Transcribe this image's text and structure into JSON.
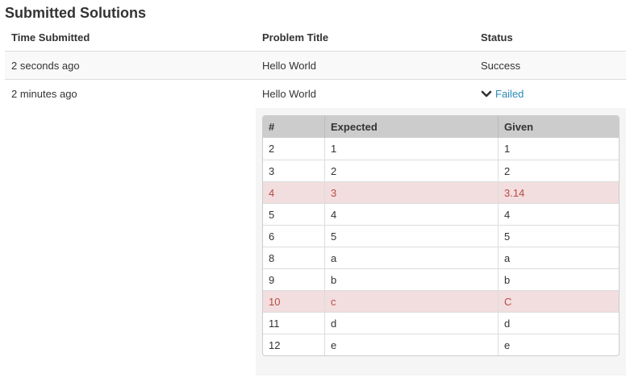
{
  "page": {
    "title": "Submitted Solutions"
  },
  "solutions_table": {
    "headers": {
      "time": "Time Submitted",
      "title": "Problem Title",
      "status": "Status"
    },
    "rows": [
      {
        "time": "2 seconds ago",
        "title": "Hello World",
        "status": "Success"
      },
      {
        "time": "2 minutes ago",
        "title": "Hello World",
        "status": "Failed"
      }
    ]
  },
  "details": {
    "headers": {
      "num": "#",
      "expected": "Expected",
      "given": "Given"
    },
    "rows": [
      {
        "num": "2",
        "expected": "1",
        "given": "1",
        "mismatch": false
      },
      {
        "num": "3",
        "expected": "2",
        "given": "2",
        "mismatch": false
      },
      {
        "num": "4",
        "expected": "3",
        "given": "3.14",
        "mismatch": true
      },
      {
        "num": "5",
        "expected": "4",
        "given": "4",
        "mismatch": false
      },
      {
        "num": "6",
        "expected": "5",
        "given": "5",
        "mismatch": false
      },
      {
        "num": "8",
        "expected": "a",
        "given": "a",
        "mismatch": false
      },
      {
        "num": "9",
        "expected": "b",
        "given": "b",
        "mismatch": false
      },
      {
        "num": "10",
        "expected": "c",
        "given": "C",
        "mismatch": true
      },
      {
        "num": "11",
        "expected": "d",
        "given": "d",
        "mismatch": false
      },
      {
        "num": "12",
        "expected": "e",
        "given": "e",
        "mismatch": false
      }
    ]
  },
  "colors": {
    "link": "#2a8ab8",
    "mismatch_bg": "#f2dede",
    "mismatch_text": "#b94a48",
    "header_bg": "#cccccc",
    "panel_bg": "#f5f5f5"
  },
  "icons": {
    "expand": "chevron-down-icon"
  }
}
